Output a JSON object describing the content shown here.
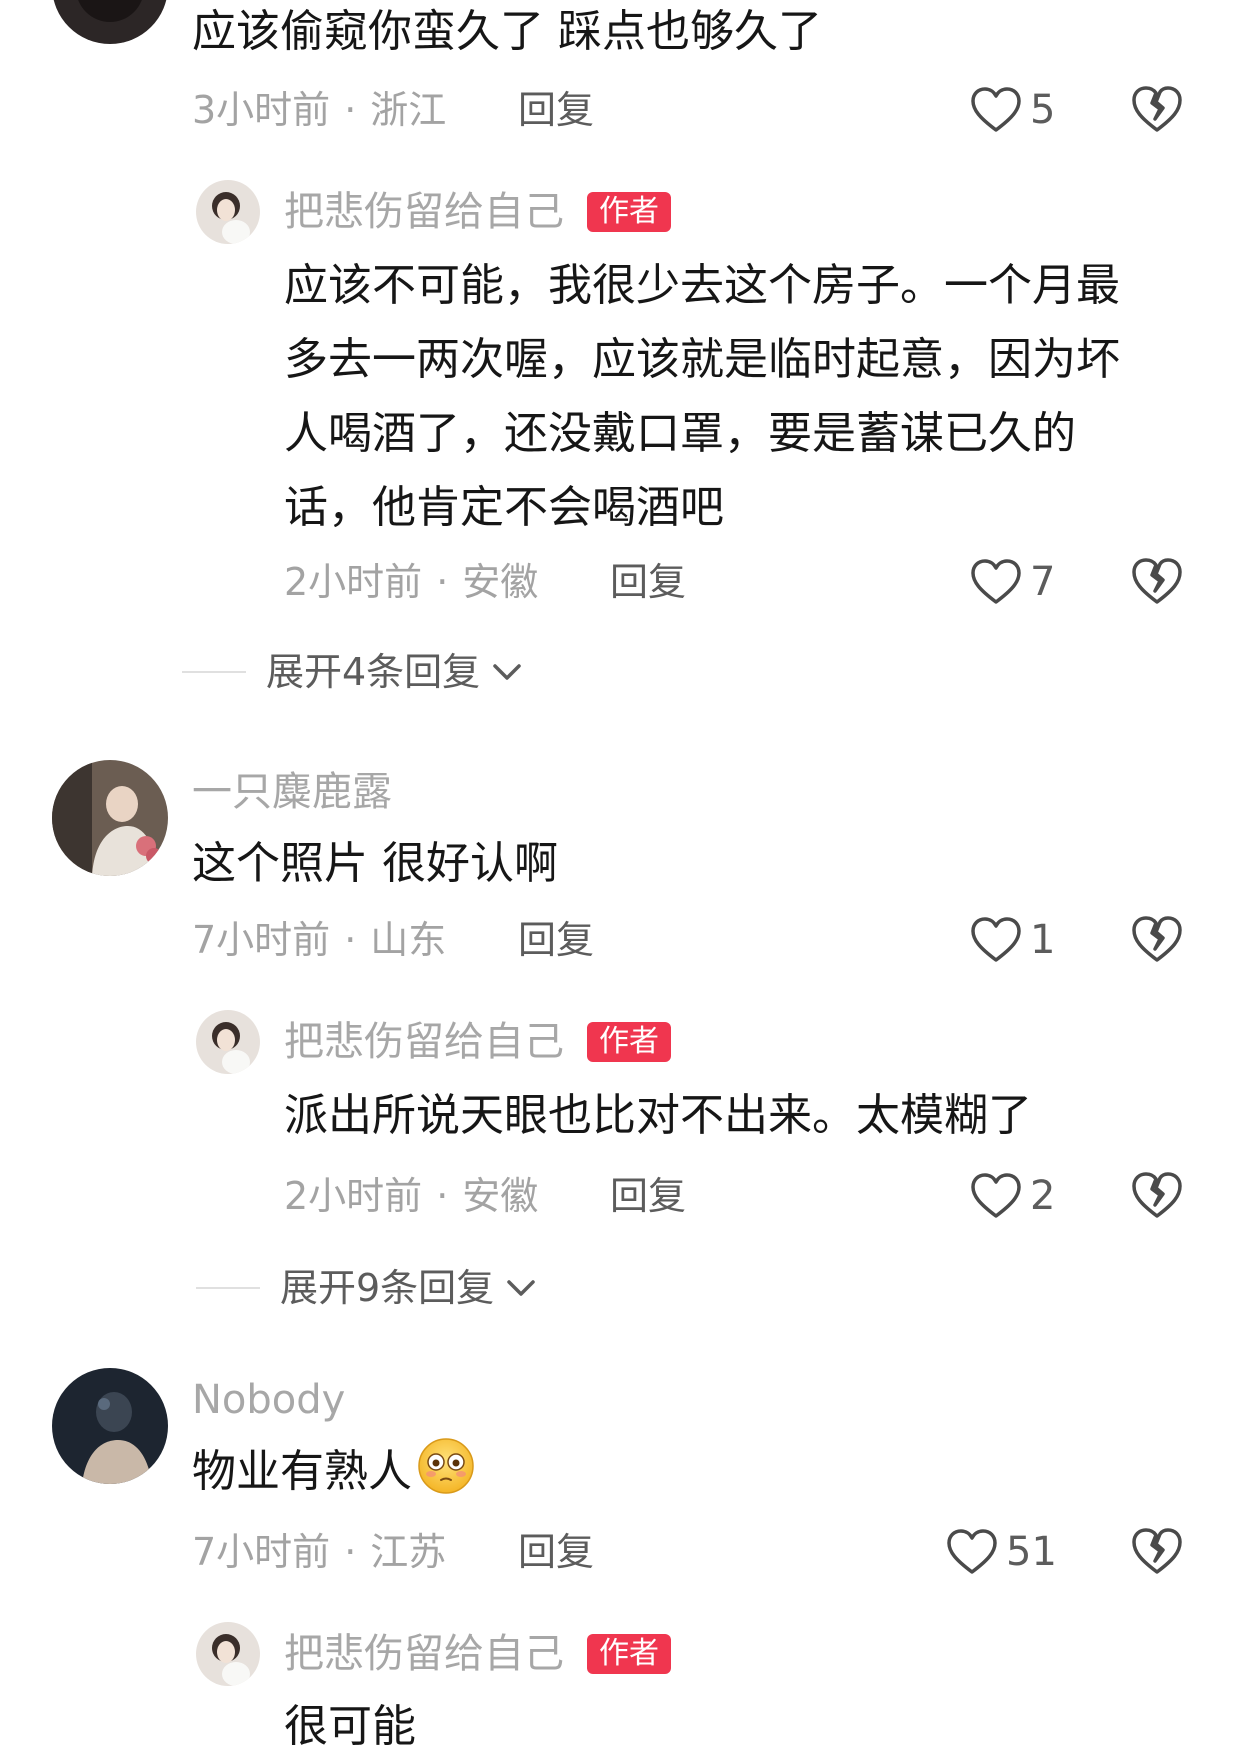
{
  "comments": [
    {
      "text": "应该偷窥你蛮久了 踩点也够久了",
      "time": "3小时前",
      "location": "浙江",
      "reply_label": "回复",
      "likes": "5",
      "author_reply": {
        "name": "把悲伤留给自己",
        "badge": "作者",
        "lines": [
          "应该不可能，我很少去这个房子。一个月最",
          "多去一两次喔，应该就是临时起意，因为坏",
          "人喝酒了，还没戴口罩，要是蓄谋已久的",
          "话，他肯定不会喝酒吧"
        ],
        "time": "2小时前",
        "location": "安徽",
        "reply_label": "回复",
        "likes": "7"
      },
      "expand_label": "展开4条回复"
    },
    {
      "name": "一只麋鹿露",
      "text": "这个照片 很好认啊",
      "time": "7小时前",
      "location": "山东",
      "reply_label": "回复",
      "likes": "1",
      "author_reply": {
        "name": "把悲伤留给自己",
        "badge": "作者",
        "text": "派出所说天眼也比对不出来。太模糊了",
        "time": "2小时前",
        "location": "安徽",
        "reply_label": "回复",
        "likes": "2"
      },
      "expand_label": "展开9条回复"
    },
    {
      "name": "Nobody",
      "text": "物业有熟人",
      "emoji": "flushed-face-emoji",
      "time": "7小时前",
      "location": "江苏",
      "reply_label": "回复",
      "likes": "51",
      "author_reply": {
        "name": "把悲伤留给自己",
        "badge": "作者",
        "text": "很可能"
      }
    }
  ],
  "separator_dot": "·",
  "colors": {
    "badge": "#f0364f",
    "text": "#161616",
    "meta": "#a3a3a3"
  }
}
